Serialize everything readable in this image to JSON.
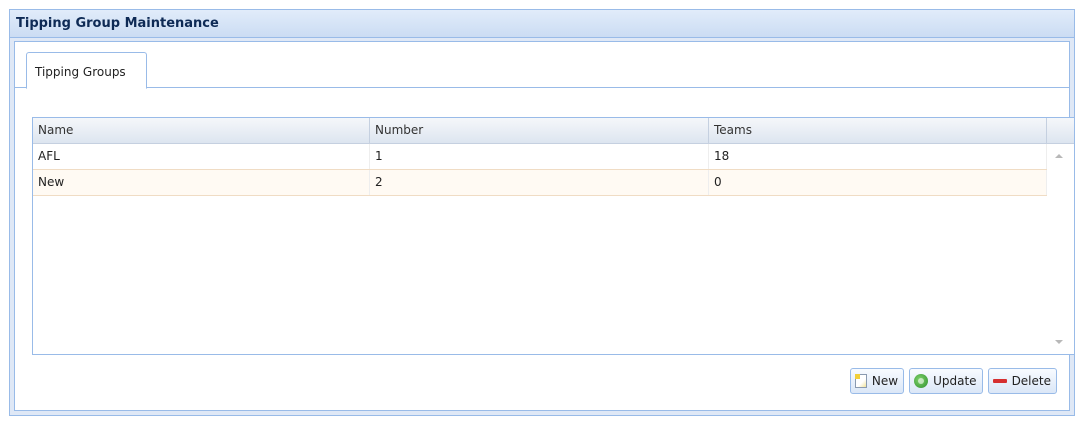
{
  "window": {
    "title": "Tipping Group Maintenance"
  },
  "tabs": [
    {
      "label": "Tipping Groups",
      "active": true
    }
  ],
  "grid": {
    "columns": [
      "Name",
      "Number",
      "Teams"
    ],
    "rows": [
      {
        "name": "AFL",
        "number": "1",
        "teams": "18"
      },
      {
        "name": "New",
        "number": "2",
        "teams": "0"
      }
    ]
  },
  "buttons": {
    "new_label": "New",
    "update_label": "Update",
    "delete_label": "Delete"
  },
  "icons": {
    "new": "new-document-icon",
    "update": "refresh-icon",
    "delete": "remove-icon"
  },
  "colors": {
    "panel_border": "#99bbe8",
    "title_text": "#15428b",
    "delete_icon": "#d62f2f",
    "update_icon": "#2f8f2f"
  }
}
